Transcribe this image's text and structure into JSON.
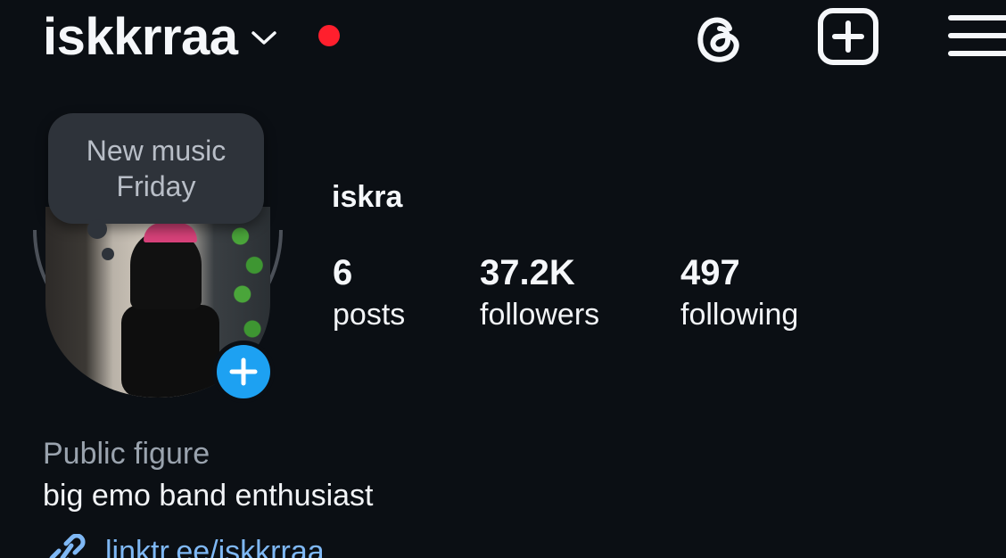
{
  "header": {
    "username": "iskkrraa",
    "icons": {
      "account_switch": "chevron-down-icon",
      "notification": "red-dot-indicator",
      "threads": "threads-icon",
      "create": "plus-square-icon",
      "menu": "hamburger-menu-icon"
    },
    "colors": {
      "notification_dot": "#ff1f2d"
    }
  },
  "note": {
    "text": "New music Friday"
  },
  "profile": {
    "display_name": "iskra",
    "add_story_icon": "plus-icon",
    "accent_color": "#1da1f2",
    "stats": [
      {
        "value": "6",
        "label": "posts"
      },
      {
        "value": "37.2K",
        "label": "followers"
      },
      {
        "value": "497",
        "label": "following"
      }
    ],
    "category": "Public figure",
    "bio": "big emo band enthusiast",
    "link": {
      "icon": "link-icon",
      "text": "linktr.ee/iskkrraa",
      "color": "#7fb8f5"
    }
  }
}
